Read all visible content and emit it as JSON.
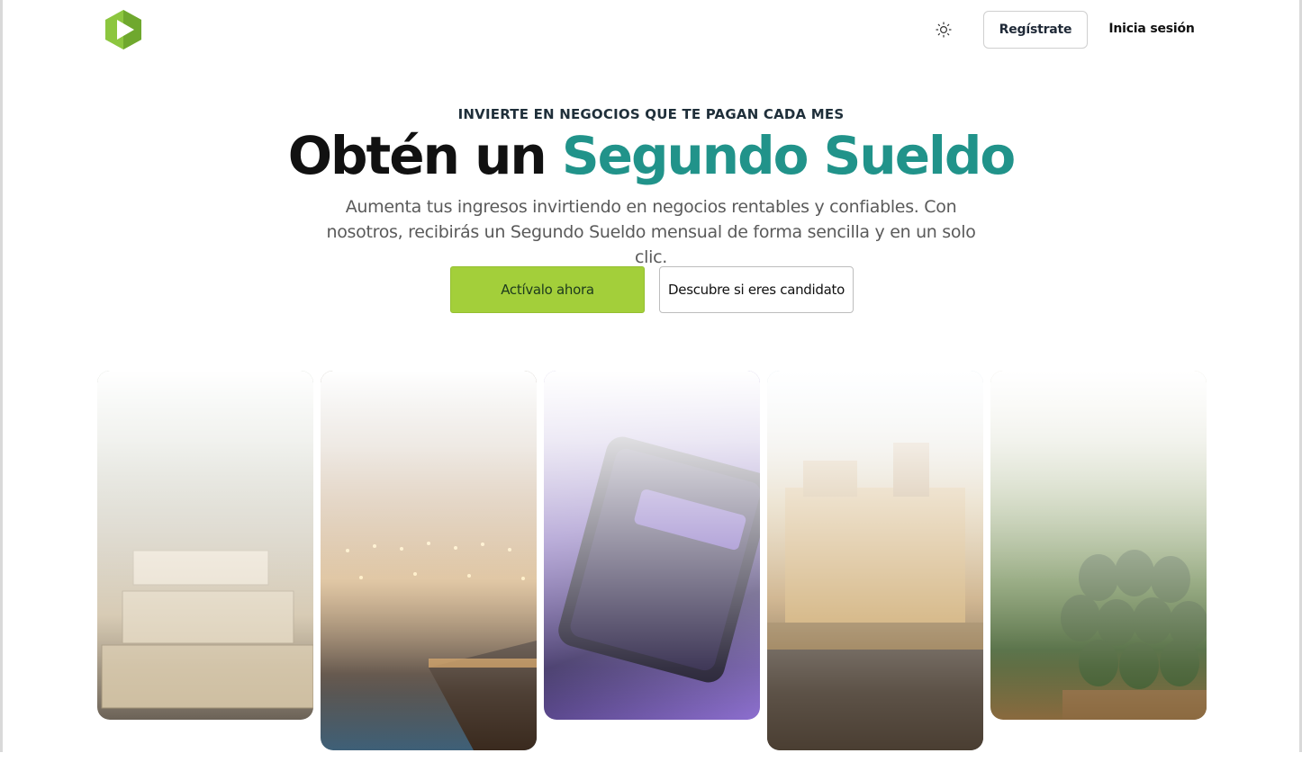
{
  "header": {
    "logo_icon": "play-hexagon-logo",
    "theme_icon": "sun-icon",
    "register_label": "Regístrate",
    "login_label": "Inicia sesión"
  },
  "hero": {
    "eyebrow": "INVIERTE EN NEGOCIOS QUE TE PAGAN CADA MES",
    "headline_part1": "Obtén un ",
    "headline_accent": "Segundo Sueldo",
    "subtitle": "Aumenta tus ingresos invirtiendo en negocios rentables y confiables. Con nosotros, recibirás un Segundo Sueldo mensual de forma sencilla y en un solo clic.",
    "primary_cta": "Actívalo ahora",
    "secondary_cta": "Descubre si eres candidato"
  },
  "colors": {
    "accent_teal": "#21938a",
    "cta_green": "#a3cf3a",
    "logo_green": "#8cc63f"
  }
}
